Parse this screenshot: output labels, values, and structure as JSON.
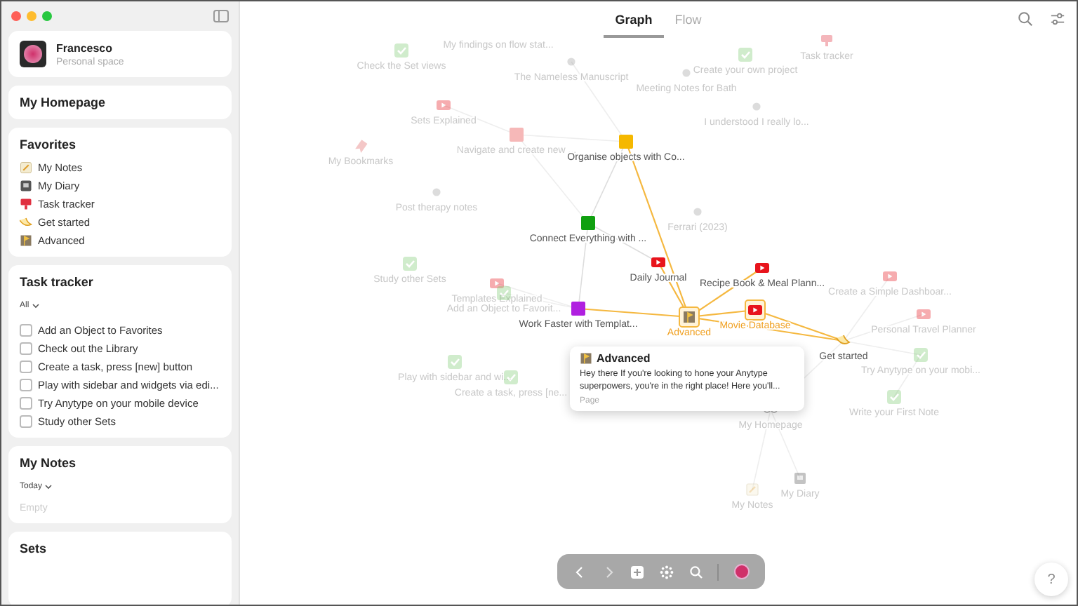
{
  "profile": {
    "name": "Francesco",
    "subtitle": "Personal space"
  },
  "home": {
    "title": "My Homepage"
  },
  "favorites": {
    "title": "Favorites",
    "items": [
      {
        "label": "My Notes",
        "kind": "note"
      },
      {
        "label": "My Diary",
        "kind": "diary"
      },
      {
        "label": "Task tracker",
        "kind": "pin"
      },
      {
        "label": "Get started",
        "kind": "started"
      },
      {
        "label": "Advanced",
        "kind": "advanced"
      }
    ]
  },
  "task_tracker": {
    "title": "Task tracker",
    "filter": "All",
    "items": [
      {
        "label": "Add an Object to Favorites",
        "checked": false
      },
      {
        "label": "Check out the Library",
        "checked": false
      },
      {
        "label": "Create a task, press [new] button",
        "checked": false
      },
      {
        "label": "Play with sidebar and widgets via edi...",
        "checked": false
      },
      {
        "label": "Try Anytype on your mobile device",
        "checked": false
      },
      {
        "label": "Study other Sets",
        "checked": false
      }
    ]
  },
  "my_notes": {
    "title": "My Notes",
    "filter": "Today",
    "empty": "Empty"
  },
  "sets": {
    "title": "Sets"
  },
  "graph": {
    "tabs": [
      {
        "label": "Graph",
        "selected": true
      },
      {
        "label": "Flow",
        "selected": false
      }
    ],
    "nodes": [
      {
        "label": "Check the Set views",
        "kind": "checkbox",
        "faded": true,
        "focused": false
      },
      {
        "label": "My findings on flow stat...",
        "kind": "none",
        "faded": true,
        "focused": false
      },
      {
        "label": "The Nameless Manuscript",
        "kind": "dot",
        "faded": true,
        "focused": false
      },
      {
        "label": "Meeting Notes for Bath",
        "kind": "dot",
        "faded": true,
        "focused": false
      },
      {
        "label": "Create your own project",
        "kind": "checkbox",
        "faded": true,
        "focused": false
      },
      {
        "label": "Task tracker",
        "kind": "pin",
        "faded": true,
        "focused": false
      },
      {
        "label": "Sets Explained",
        "kind": "video",
        "faded": true,
        "focused": false
      },
      {
        "label": "I understood I really lo...",
        "kind": "dot",
        "faded": true,
        "focused": false
      },
      {
        "label": "My Bookmarks",
        "kind": "bookmark",
        "faded": true,
        "focused": false
      },
      {
        "label": "Navigate and create new ...",
        "kind": "square",
        "faded": true,
        "focused": false,
        "color": "#f6b8b8"
      },
      {
        "label": "Organise objects with Co...",
        "kind": "square",
        "faded": false,
        "focused": false,
        "color": "#f5b800"
      },
      {
        "label": "Post therapy notes",
        "kind": "dot",
        "faded": true,
        "focused": false
      },
      {
        "label": "Connect Everything with ...",
        "kind": "square",
        "faded": false,
        "focused": false,
        "color": "#10a010"
      },
      {
        "label": "Ferrari (2023)",
        "kind": "dot",
        "faded": true,
        "focused": false
      },
      {
        "label": "Study other Sets",
        "kind": "checkbox",
        "faded": true,
        "focused": false
      },
      {
        "label": "Daily Journal",
        "kind": "video",
        "faded": false,
        "focused": false
      },
      {
        "label": "Recipe Book & Meal Plann...",
        "kind": "video",
        "faded": false,
        "focused": false
      },
      {
        "label": "Create a Simple Dashboar...",
        "kind": "video",
        "faded": true,
        "focused": false
      },
      {
        "label": "Templates Explained",
        "kind": "video",
        "faded": true,
        "focused": false
      },
      {
        "label": "Add an Object to Favorit...",
        "kind": "checkbox",
        "faded": true,
        "focused": false
      },
      {
        "label": "Work Faster with Templat...",
        "kind": "square",
        "faded": false,
        "focused": false,
        "color": "#b020e0"
      },
      {
        "label": "Advanced",
        "kind": "advanced",
        "faded": false,
        "focused": true
      },
      {
        "label": "Movie Database",
        "kind": "video",
        "faded": false,
        "focused": true
      },
      {
        "label": "Personal Travel Planner",
        "kind": "video",
        "faded": true,
        "focused": false
      },
      {
        "label": "Play with sidebar and wi...",
        "kind": "checkbox",
        "faded": true,
        "focused": false
      },
      {
        "label": "Get started",
        "kind": "started",
        "faded": false,
        "focused": false
      },
      {
        "label": "Try Anytype on your mobi...",
        "kind": "checkbox",
        "faded": true,
        "focused": false
      },
      {
        "label": "Create a task, press [ne...",
        "kind": "checkbox",
        "faded": true,
        "focused": false
      },
      {
        "label": "Write your First Note",
        "kind": "checkbox",
        "faded": true,
        "focused": false
      },
      {
        "label": "My Homepage",
        "kind": "home",
        "faded": true,
        "focused": false
      },
      {
        "label": "My Diary",
        "kind": "diary",
        "faded": true,
        "focused": false
      },
      {
        "label": "My Notes",
        "kind": "note",
        "faded": true,
        "focused": false
      }
    ],
    "tooltip": {
      "title": "Advanced",
      "text": "Hey there If you're looking to hone your Anytype superpowers, you're in the right place! Here you'll...",
      "type": "Page"
    }
  },
  "help": {
    "label": "?"
  }
}
